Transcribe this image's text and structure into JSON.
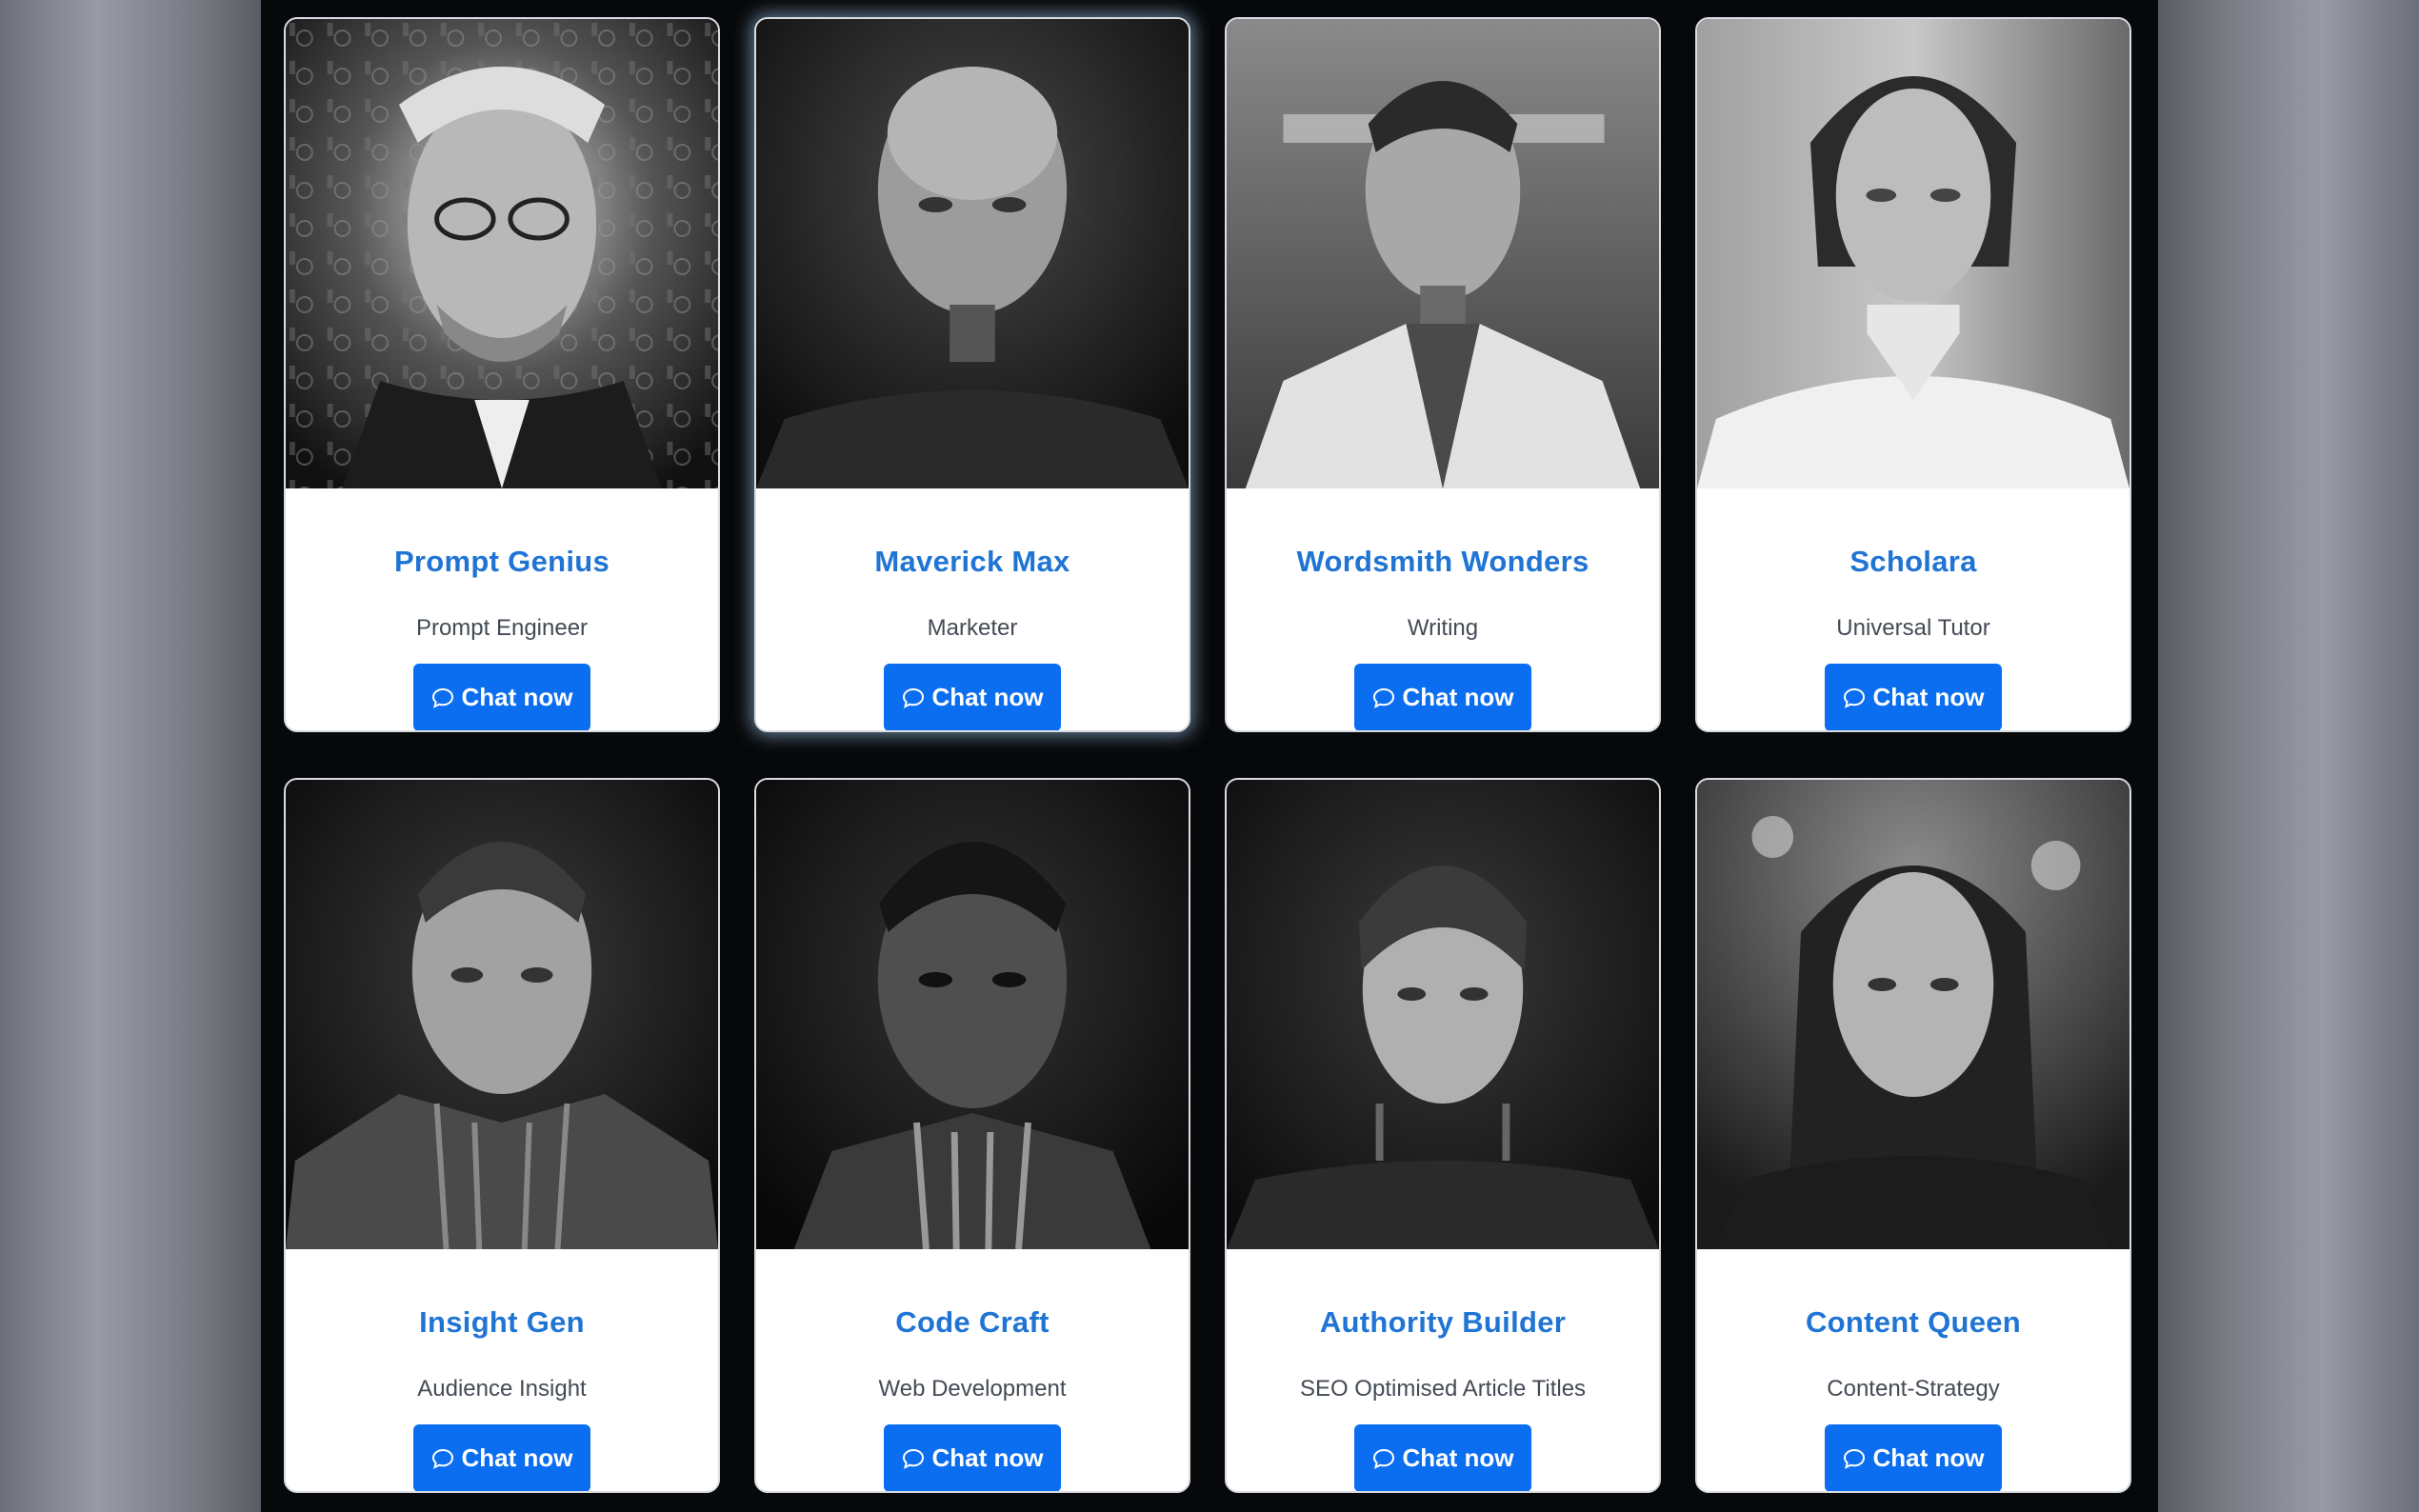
{
  "cards": [
    {
      "name": "Prompt Genius",
      "role": "Prompt Engineer",
      "cta": "Chat now"
    },
    {
      "name": "Maverick Max",
      "role": "Marketer",
      "cta": "Chat now"
    },
    {
      "name": "Wordsmith Wonders",
      "role": "Writing",
      "cta": "Chat now"
    },
    {
      "name": "Scholara",
      "role": "Universal Tutor",
      "cta": "Chat now"
    },
    {
      "name": "Insight Gen",
      "role": "Audience Insight",
      "cta": "Chat now"
    },
    {
      "name": "Code Craft",
      "role": "Web Development",
      "cta": "Chat now"
    },
    {
      "name": "Authority Builder",
      "role": "SEO Optimised Article Titles",
      "cta": "Chat now"
    },
    {
      "name": "Content Queen",
      "role": "Content-Strategy",
      "cta": "Chat now"
    }
  ],
  "colors": {
    "accent": "#1f74d4",
    "button": "#0b6ef0",
    "stage": "#070809"
  },
  "icons": {
    "button_icon": "chat-bubble-icon"
  }
}
